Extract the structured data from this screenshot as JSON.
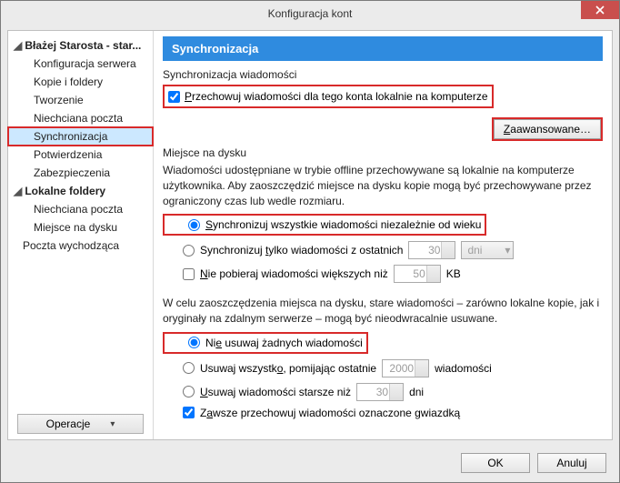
{
  "window": {
    "title": "Konfiguracja kont"
  },
  "sidebar": {
    "account": "Błażej Starosta - star...",
    "children": [
      "Konfiguracja serwera",
      "Kopie i foldery",
      "Tworzenie",
      "Niechciana poczta",
      "Synchronizacja",
      "Potwierdzenia",
      "Zabezpieczenia"
    ],
    "localFolders": "Lokalne foldery",
    "localChildren": [
      "Niechciana poczta",
      "Miejsce na dysku"
    ],
    "outgoing": "Poczta wychodząca",
    "operations": "Operacje"
  },
  "main": {
    "header": "Synchronizacja",
    "syncSection": "Synchronizacja wiadomości",
    "storeLocal": "Przechowuj wiadomości dla tego konta lokalnie na komputerze",
    "advanced": "Zaawansowane…",
    "diskSection": "Miejsce na dysku",
    "diskDesc": "Wiadomości udostępniane w trybie offline przechowywane są lokalnie na komputerze użytkownika. Aby zaoszczędzić miejsce na dysku kopie mogą być przechowywane przez ograniczony czas lub wedle rozmiaru.",
    "syncAll": "Synchronizuj wszystkie wiadomości niezależnie od wieku",
    "syncRecent": "Synchronizuj tylko wiadomości z ostatnich",
    "syncRecentVal": "30",
    "syncRecentUnit": "dni",
    "noLarge": "Nie pobieraj wiadomości większych niż",
    "noLargeVal": "50",
    "noLargeUnit": "KB",
    "purgeDesc": "W celu zaoszczędzenia miejsca na dysku, stare wiadomości – zarówno lokalne kopie, jak i oryginały na zdalnym serwerze – mogą być nieodwracalnie usuwane.",
    "delNone": "Nie usuwaj żadnych wiadomości",
    "delKeep": "Usuwaj wszystko, pomijając ostatnie",
    "delKeepVal": "2000",
    "delKeepUnit": "wiadomości",
    "delOld": "Usuwaj wiadomości starsze niż",
    "delOldVal": "30",
    "delOldUnit": "dni",
    "keepStar": "Zawsze przechowuj wiadomości oznaczone gwiazdką"
  },
  "footer": {
    "ok": "OK",
    "cancel": "Anuluj"
  }
}
